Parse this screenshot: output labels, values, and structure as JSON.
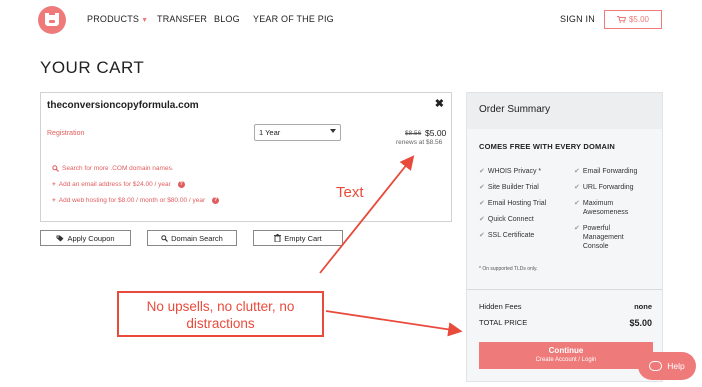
{
  "nav": {
    "items": [
      {
        "label": "PRODUCTS",
        "has_dropdown": true
      },
      {
        "label": "TRANSFER"
      },
      {
        "label": "BLOG"
      },
      {
        "label": "YEAR OF THE PIG"
      }
    ],
    "sign_in": "SIGN IN",
    "cart_label": "$5.00",
    "brand_color": "#ef7a7a"
  },
  "page": {
    "title": "YOUR CART"
  },
  "cart": {
    "domain": "theconversioncopyformula.com",
    "registration_label": "Registration",
    "term_selected": "1 Year",
    "old_price": "$8.56",
    "price": "$5.00",
    "renews": "renews at $8.56",
    "upsells": [
      {
        "icon": "search-icon",
        "text": "Search for more .COM domain names.",
        "has_help": false
      },
      {
        "icon": "plus-icon",
        "text": "Add an email address for $24.00 / year",
        "has_help": true
      },
      {
        "icon": "plus-icon",
        "text": "Add web hosting for $8.00 / month or $80.00 / year",
        "has_help": true
      }
    ]
  },
  "actions": {
    "apply_coupon": "Apply Coupon",
    "domain_search": "Domain Search",
    "empty_cart": "Empty Cart"
  },
  "annotations": {
    "text_label": "Text",
    "box_text": "No upsells, no clutter, no distractions",
    "color": "#e84b3c"
  },
  "summary": {
    "title": "Order Summary",
    "free_title": "COMES FREE WITH EVERY DOMAIN",
    "features_left": [
      "WHOIS Privacy *",
      "Site Builder Trial",
      "Email Hosting Trial",
      "Quick Connect",
      "SSL Certificate"
    ],
    "features_right": [
      "Email Forwarding",
      "URL Forwarding",
      "Maximum Awesomeness",
      "Powerful Management Console"
    ],
    "note": "* On supported TLDs only.",
    "hidden_fees_label": "Hidden Fees",
    "hidden_fees_value": "none",
    "total_label": "TOTAL PRICE",
    "total_value": "$5.00",
    "continue_label": "Continue",
    "continue_sub": "Create Account / Login"
  },
  "help": {
    "label": "Help"
  }
}
